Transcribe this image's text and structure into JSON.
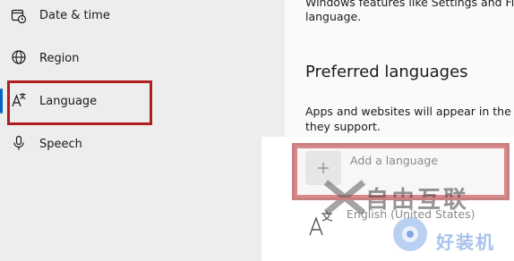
{
  "sidebar": {
    "items": [
      {
        "label": "Date & time",
        "icon": "calendar-clock-icon"
      },
      {
        "label": "Region",
        "icon": "globe-icon"
      },
      {
        "label": "Language",
        "icon": "language-icon",
        "selected": true
      },
      {
        "label": "Speech",
        "icon": "microphone-icon"
      }
    ]
  },
  "main": {
    "intro_line1": "Windows features like Settings and Fi",
    "intro_line2": "language.",
    "preferred_heading": "Preferred languages",
    "pref_desc_line1": "Apps and websites will appear in the f",
    "pref_desc_line2": "they support.",
    "add_language_label": "Add a language",
    "installed_languages": [
      "English (United States)"
    ]
  },
  "watermark": {
    "line1": "自由互联",
    "line2": "好装机"
  },
  "colors": {
    "accent": "#0067c0",
    "highlight_red": "#b01e1e",
    "highlight_pink": "#d9898b",
    "watermark_blue": "#3a78d8"
  }
}
